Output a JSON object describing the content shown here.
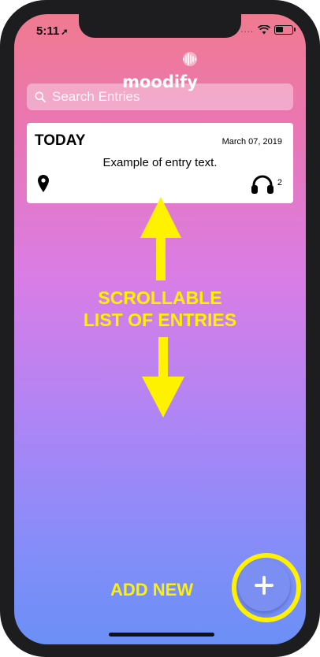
{
  "status_bar": {
    "time": "5:11",
    "location_glyph": "➚",
    "cellular_dots": "....",
    "icons": [
      "wifi-icon",
      "battery-charging-icon"
    ]
  },
  "app": {
    "title": "moodify"
  },
  "search": {
    "placeholder": "Search Entries"
  },
  "entries": [
    {
      "title": "TODAY",
      "date": "March 07, 2019",
      "text": "Example of entry text.",
      "icons": [
        "location-pin-icon",
        "headphones-icon"
      ],
      "song_count": "2"
    }
  ],
  "annotations": {
    "scroll_line1": "SCROLLABLE",
    "scroll_line2": "LIST OF ENTRIES",
    "add_new": "ADD NEW"
  },
  "colors": {
    "gradient_top": "#f07a8f",
    "gradient_mid": "#d97de6",
    "gradient_bottom": "#6b8ff6",
    "annotation": "#fff200",
    "add_button": "#7b8ff2"
  },
  "fab": {
    "icon": "plus-icon"
  }
}
